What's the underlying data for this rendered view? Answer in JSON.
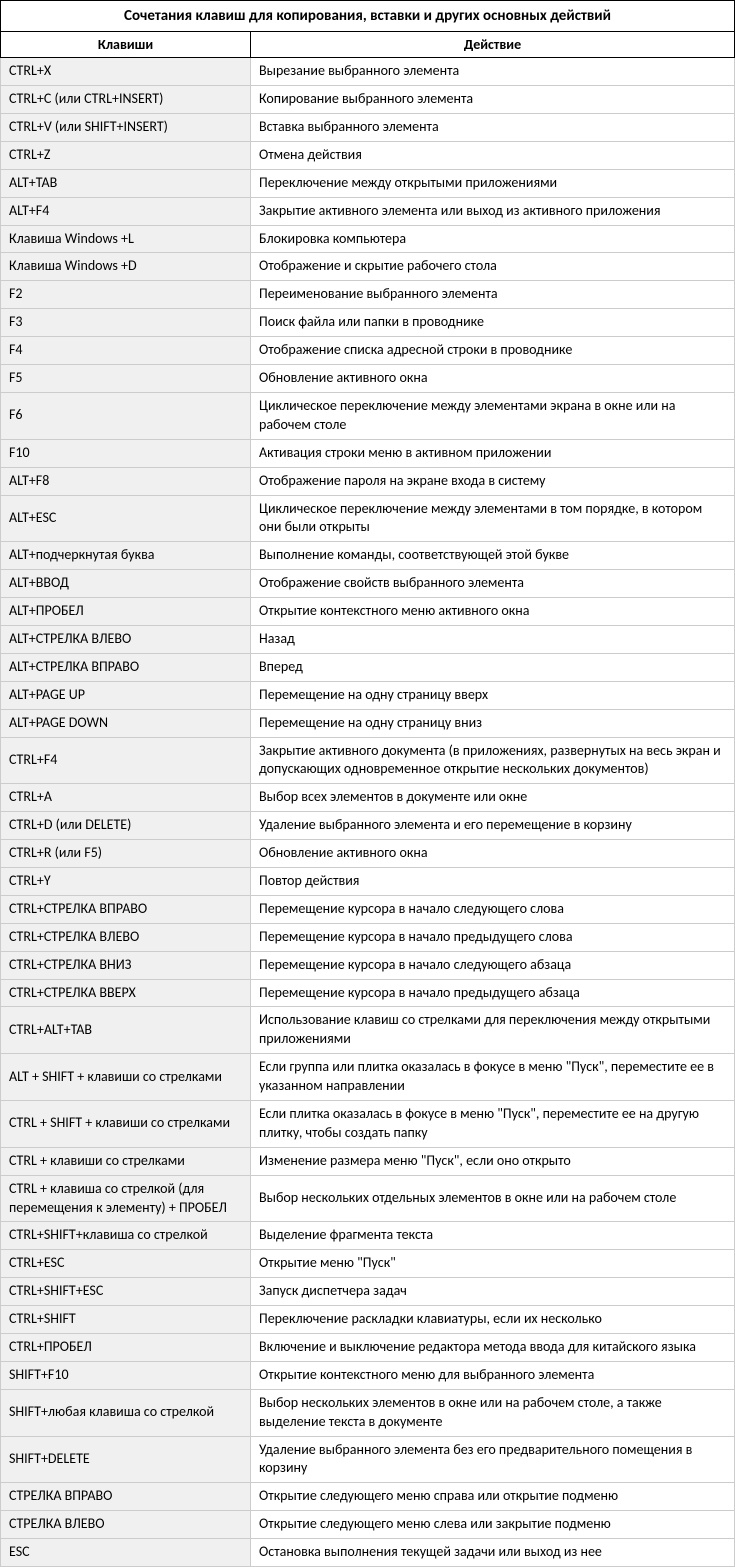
{
  "title": "Сочетания клавиш для копирования, вставки и других основных действий",
  "headers": {
    "keys": "Клавиши",
    "action": "Действие"
  },
  "rows": [
    {
      "k": "CTRL+X",
      "a": "Вырезание выбранного элемента"
    },
    {
      "k": "CTRL+C (или CTRL+INSERT)",
      "a": "Копирование выбранного элемента"
    },
    {
      "k": "CTRL+V (или SHIFT+INSERT)",
      "a": "Вставка выбранного элемента"
    },
    {
      "k": "CTRL+Z",
      "a": "Отмена действия"
    },
    {
      "k": "ALT+TAB",
      "a": "Переключение между открытыми приложениями"
    },
    {
      "k": "ALT+F4",
      "a": "Закрытие активного элемента или выход из активного приложения"
    },
    {
      "k": "Клавиша Windows  +L",
      "a": "Блокировка компьютера"
    },
    {
      "k": "Клавиша Windows  +D",
      "a": "Отображение и скрытие рабочего стола"
    },
    {
      "k": "F2",
      "a": "Переименование выбранного элемента"
    },
    {
      "k": "F3",
      "a": "Поиск файла или папки в проводнике"
    },
    {
      "k": "F4",
      "a": "Отображение списка адресной строки в проводнике"
    },
    {
      "k": "F5",
      "a": "Обновление активного окна"
    },
    {
      "k": "F6",
      "a": "Циклическое переключение между элементами экрана в окне или на рабочем столе"
    },
    {
      "k": "F10",
      "a": "Активация строки меню в активном приложении"
    },
    {
      "k": "ALT+F8",
      "a": "Отображение пароля на экране входа в систему"
    },
    {
      "k": "ALT+ESC",
      "a": "Циклическое переключение между элементами в том порядке, в котором они были открыты"
    },
    {
      "k": "ALT+подчеркнутая буква",
      "a": "Выполнение команды, соответствующей этой букве"
    },
    {
      "k": "ALT+ВВОД",
      "a": "Отображение свойств выбранного элемента"
    },
    {
      "k": "ALT+ПРОБЕЛ",
      "a": "Открытие контекстного меню активного окна"
    },
    {
      "k": "ALT+СТРЕЛКА ВЛЕВО",
      "a": "Назад"
    },
    {
      "k": "ALT+СТРЕЛКА ВПРАВО",
      "a": "Вперед"
    },
    {
      "k": "ALT+PAGE UP",
      "a": "Перемещение на одну страницу вверх"
    },
    {
      "k": "ALT+PAGE DOWN",
      "a": "Перемещение на одну страницу вниз"
    },
    {
      "k": "CTRL+F4",
      "a": "Закрытие активного документа (в приложениях, развернутых на весь экран и допускающих одновременное открытие нескольких документов)"
    },
    {
      "k": "CTRL+A",
      "a": "Выбор всех элементов в документе или окне"
    },
    {
      "k": "CTRL+D (или DELETE)",
      "a": "Удаление выбранного элемента и его перемещение в корзину"
    },
    {
      "k": "CTRL+R (или F5)",
      "a": "Обновление активного окна"
    },
    {
      "k": "CTRL+Y",
      "a": "Повтор действия"
    },
    {
      "k": "CTRL+СТРЕЛКА ВПРАВО",
      "a": "Перемещение курсора в начало следующего слова"
    },
    {
      "k": "CTRL+СТРЕЛКА ВЛЕВО",
      "a": "Перемещение курсора в начало предыдущего слова"
    },
    {
      "k": "CTRL+СТРЕЛКА ВНИЗ",
      "a": "Перемещение курсора в начало следующего абзаца"
    },
    {
      "k": "CTRL+СТРЕЛКА ВВЕРХ",
      "a": "Перемещение курсора в начало предыдущего абзаца"
    },
    {
      "k": "CTRL+ALT+TAB",
      "a": "Использование клавиш со стрелками для переключения между открытыми приложениями"
    },
    {
      "k": "ALT + SHIFT + клавиши со стрелками",
      "a": "Если группа или плитка оказалась в фокусе в меню \"Пуск\", переместите ее в указанном направлении"
    },
    {
      "k": "CTRL + SHIFT + клавиши со стрелками",
      "a": "Если плитка оказалась в фокусе в меню \"Пуск\", переместите ее на другую плитку, чтобы создать папку"
    },
    {
      "k": "CTRL + клавиши со стрелками",
      "a": "Изменение размера меню \"Пуск\", если оно открыто"
    },
    {
      "k": "CTRL + клавиша со стрелкой (для перемещения к элементу) + ПРОБЕЛ",
      "a": "Выбор нескольких отдельных элементов в окне или на рабочем столе"
    },
    {
      "k": "CTRL+SHIFT+клавиша со стрелкой",
      "a": "Выделение фрагмента текста"
    },
    {
      "k": "CTRL+ESC",
      "a": "Открытие меню \"Пуск\""
    },
    {
      "k": "CTRL+SHIFT+ESC",
      "a": "Запуск диспетчера задач"
    },
    {
      "k": "CTRL+SHIFT",
      "a": "Переключение раскладки клавиатуры, если их несколько"
    },
    {
      "k": "CTRL+ПРОБЕЛ",
      "a": "Включение и выключение редактора метода ввода для китайского языка"
    },
    {
      "k": "SHIFT+F10",
      "a": "Открытие контекстного меню для выбранного элемента"
    },
    {
      "k": "SHIFT+любая клавиша со стрелкой",
      "a": "Выбор нескольких элементов в окне или на рабочем столе, а также выделение текста в документе"
    },
    {
      "k": "SHIFT+DELETE",
      "a": "Удаление выбранного элемента без его предварительного помещения в корзину"
    },
    {
      "k": "СТРЕЛКА ВПРАВО",
      "a": "Открытие следующего меню справа или открытие подменю"
    },
    {
      "k": "СТРЕЛКА ВЛЕВО",
      "a": "Открытие следующего меню слева или закрытие подменю"
    },
    {
      "k": "ESC",
      "a": "Остановка выполнения текущей задачи или выход из нее"
    }
  ]
}
